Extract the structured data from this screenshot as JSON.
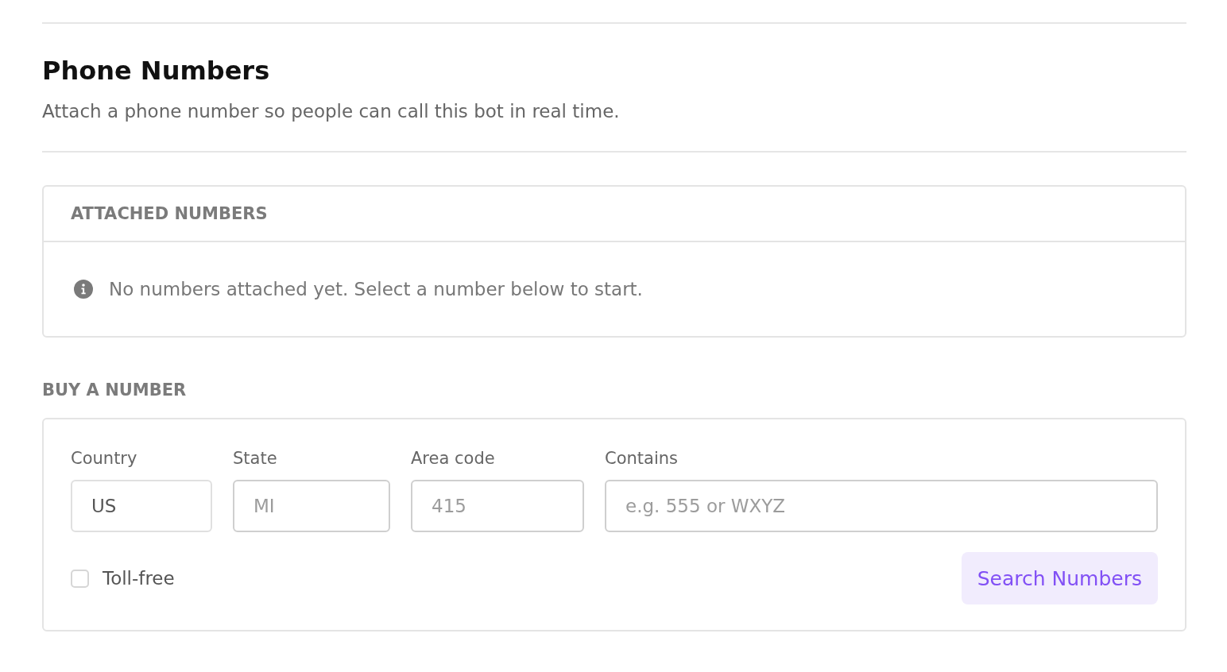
{
  "section": {
    "title": "Phone Numbers",
    "description": "Attach a phone number so people can call this bot in real time."
  },
  "attached_numbers": {
    "heading": "ATTACHED NUMBERS",
    "empty_message": "No numbers attached yet. Select a number below to start."
  },
  "buy_number": {
    "heading": "BUY A NUMBER",
    "fields": [
      {
        "label": "Country",
        "value": "US"
      },
      {
        "label": "State",
        "placeholder": "MI"
      },
      {
        "label": "Area code",
        "placeholder": "415"
      },
      {
        "label": "Contains",
        "placeholder": "e.g. 555 or WXYZ"
      }
    ],
    "toll_free": {
      "label": "Toll-free",
      "checked": false
    },
    "search_button": "Search Numbers"
  }
}
